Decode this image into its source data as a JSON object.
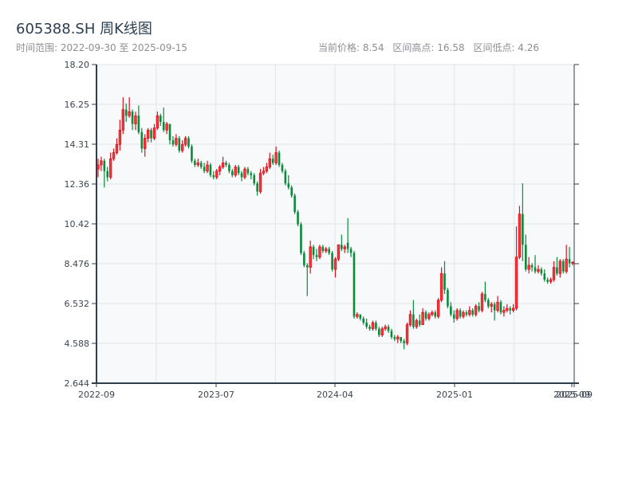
{
  "header": {
    "title": "605388.SH 周K线图",
    "range_label": "时间范围: 2022-09-30 至 2025-09-15",
    "current_price": "当前价格: 8.54",
    "range_high": "区间高点: 16.58",
    "range_low": "区间低点: 4.26"
  },
  "chart_data": {
    "type": "candlestick",
    "title": "605388.SH 周K线图",
    "ylim": [
      2.644,
      18.2
    ],
    "y_ticks": [
      "18.20",
      "16.25",
      "14.31",
      "12.36",
      "10.42",
      "8.476",
      "6.532",
      "4.588",
      "2.644"
    ],
    "x_ticks": [
      "2022-09",
      "2023-07",
      "2024-04",
      "2025-01",
      "2025-09",
      "2025-09"
    ],
    "grid": true,
    "colors": {
      "up": "#e0101e",
      "up_fill": "#f23c3c",
      "down": "#0b8a3a",
      "plot_bg": "#f7f9fb",
      "axis": "#2c3e50",
      "grid": "#e1e5ea"
    },
    "ohlc_fields": [
      "open",
      "high",
      "low",
      "close"
    ],
    "candles": [
      [
        13.1,
        13.6,
        12.7,
        13.3
      ],
      [
        13.3,
        13.7,
        13.0,
        13.5
      ],
      [
        13.5,
        13.6,
        12.2,
        13.0
      ],
      [
        13.0,
        13.2,
        12.5,
        12.7
      ],
      [
        12.7,
        13.9,
        12.6,
        13.6
      ],
      [
        13.6,
        14.1,
        13.5,
        13.9
      ],
      [
        13.9,
        14.6,
        13.8,
        14.3
      ],
      [
        14.3,
        15.5,
        14.0,
        15.0
      ],
      [
        15.0,
        16.6,
        14.8,
        16.0
      ],
      [
        16.0,
        16.3,
        15.4,
        15.7
      ],
      [
        15.7,
        16.6,
        15.6,
        15.9
      ],
      [
        15.9,
        16.0,
        15.0,
        15.3
      ],
      [
        15.3,
        15.9,
        15.0,
        15.7
      ],
      [
        15.7,
        16.2,
        14.8,
        14.9
      ],
      [
        14.9,
        15.1,
        13.9,
        14.1
      ],
      [
        14.1,
        14.8,
        13.7,
        14.6
      ],
      [
        14.6,
        15.1,
        14.4,
        15.0
      ],
      [
        15.0,
        15.1,
        14.4,
        14.6
      ],
      [
        14.6,
        15.3,
        14.5,
        15.1
      ],
      [
        15.1,
        15.9,
        15.0,
        15.7
      ],
      [
        15.7,
        15.8,
        15.2,
        15.4
      ],
      [
        15.4,
        16.1,
        14.9,
        15.0
      ],
      [
        15.0,
        15.4,
        14.8,
        15.3
      ],
      [
        15.3,
        15.3,
        14.3,
        14.5
      ],
      [
        14.5,
        14.7,
        14.2,
        14.3
      ],
      [
        14.3,
        14.8,
        14.2,
        14.6
      ],
      [
        14.6,
        14.7,
        13.9,
        14.0
      ],
      [
        14.0,
        14.5,
        13.9,
        14.3
      ],
      [
        14.3,
        14.7,
        14.2,
        14.6
      ],
      [
        14.6,
        14.7,
        14.1,
        14.2
      ],
      [
        14.2,
        14.3,
        13.4,
        13.5
      ],
      [
        13.5,
        13.6,
        13.2,
        13.3
      ],
      [
        13.3,
        13.6,
        13.2,
        13.4
      ],
      [
        13.4,
        13.5,
        13.1,
        13.2
      ],
      [
        13.2,
        13.4,
        12.9,
        13.0
      ],
      [
        13.0,
        13.5,
        12.9,
        13.3
      ],
      [
        13.3,
        13.4,
        12.7,
        12.8
      ],
      [
        12.8,
        13.0,
        12.6,
        12.7
      ],
      [
        12.7,
        13.1,
        12.6,
        13.0
      ],
      [
        13.0,
        13.3,
        12.8,
        13.2
      ],
      [
        13.2,
        13.7,
        13.1,
        13.4
      ],
      [
        13.4,
        13.5,
        13.2,
        13.3
      ],
      [
        13.3,
        13.4,
        12.9,
        13.0
      ],
      [
        13.0,
        13.1,
        12.7,
        12.8
      ],
      [
        12.8,
        13.3,
        12.7,
        13.2
      ],
      [
        13.2,
        13.3,
        12.8,
        12.9
      ],
      [
        12.9,
        13.0,
        12.5,
        12.7
      ],
      [
        12.7,
        13.2,
        12.6,
        13.1
      ],
      [
        13.1,
        13.2,
        12.8,
        12.9
      ],
      [
        12.9,
        13.0,
        12.6,
        12.8
      ],
      [
        12.8,
        12.9,
        12.3,
        12.4
      ],
      [
        12.4,
        12.5,
        11.8,
        12.0
      ],
      [
        12.0,
        13.1,
        11.9,
        12.9
      ],
      [
        12.9,
        13.2,
        12.8,
        13.0
      ],
      [
        13.0,
        13.4,
        12.9,
        13.2
      ],
      [
        13.2,
        13.9,
        13.1,
        13.6
      ],
      [
        13.6,
        13.8,
        13.3,
        13.4
      ],
      [
        13.4,
        14.2,
        13.3,
        13.9
      ],
      [
        13.9,
        14.0,
        13.2,
        13.3
      ],
      [
        13.3,
        13.4,
        12.9,
        13.0
      ],
      [
        13.0,
        13.1,
        12.3,
        12.4
      ],
      [
        12.4,
        12.8,
        12.1,
        12.2
      ],
      [
        12.2,
        12.3,
        11.7,
        11.8
      ],
      [
        11.8,
        11.9,
        10.9,
        11.0
      ],
      [
        11.0,
        11.1,
        10.3,
        10.4
      ],
      [
        10.4,
        10.5,
        8.9,
        9.0
      ],
      [
        9.0,
        9.1,
        8.3,
        8.4
      ],
      [
        8.4,
        8.5,
        6.9,
        8.3
      ],
      [
        8.3,
        9.6,
        8.0,
        9.3
      ],
      [
        9.3,
        9.4,
        8.7,
        8.9
      ],
      [
        8.9,
        9.2,
        8.6,
        8.8
      ],
      [
        8.8,
        9.4,
        8.7,
        9.3
      ],
      [
        9.3,
        9.4,
        9.0,
        9.1
      ],
      [
        9.1,
        9.3,
        9.0,
        9.2
      ],
      [
        9.2,
        9.3,
        8.9,
        9.0
      ],
      [
        9.0,
        9.1,
        8.1,
        8.2
      ],
      [
        8.2,
        8.8,
        7.8,
        8.7
      ],
      [
        8.7,
        9.4,
        8.6,
        9.4
      ],
      [
        9.4,
        9.9,
        9.1,
        9.2
      ],
      [
        9.2,
        9.4,
        9.0,
        9.3
      ],
      [
        9.5,
        10.7,
        9.0,
        9.2
      ],
      [
        9.2,
        9.3,
        8.8,
        9.0
      ],
      [
        9.0,
        9.1,
        5.8,
        5.9
      ],
      [
        5.9,
        6.1,
        5.8,
        6.0
      ],
      [
        6.0,
        6.0,
        5.7,
        5.8
      ],
      [
        5.8,
        5.9,
        5.5,
        5.6
      ],
      [
        5.6,
        5.8,
        5.3,
        5.4
      ],
      [
        5.4,
        5.5,
        5.2,
        5.3
      ],
      [
        5.3,
        5.7,
        5.2,
        5.6
      ],
      [
        5.6,
        5.7,
        5.2,
        5.3
      ],
      [
        5.3,
        5.4,
        4.9,
        5.0
      ],
      [
        5.0,
        5.4,
        4.9,
        5.3
      ],
      [
        5.3,
        5.5,
        5.2,
        5.4
      ],
      [
        5.4,
        5.5,
        5.1,
        5.2
      ],
      [
        5.2,
        5.3,
        4.8,
        4.9
      ],
      [
        4.9,
        5.0,
        4.7,
        4.8
      ],
      [
        4.8,
        5.0,
        4.6,
        4.9
      ],
      [
        4.9,
        4.9,
        4.6,
        4.7
      ],
      [
        4.7,
        4.8,
        4.3,
        4.6
      ],
      [
        4.6,
        5.6,
        4.5,
        5.5
      ],
      [
        5.5,
        6.2,
        5.4,
        6.0
      ],
      [
        6.0,
        6.7,
        5.3,
        5.4
      ],
      [
        5.4,
        5.8,
        5.3,
        5.7
      ],
      [
        5.7,
        6.0,
        5.4,
        5.5
      ],
      [
        5.5,
        6.3,
        5.5,
        6.1
      ],
      [
        6.1,
        6.2,
        5.7,
        5.8
      ],
      [
        5.8,
        6.1,
        5.7,
        6.0
      ],
      [
        6.0,
        6.2,
        5.9,
        6.1
      ],
      [
        6.1,
        6.2,
        5.8,
        5.9
      ],
      [
        5.9,
        6.8,
        5.8,
        6.7
      ],
      [
        6.7,
        8.3,
        6.6,
        8.0
      ],
      [
        8.0,
        8.6,
        7.0,
        7.2
      ],
      [
        7.2,
        7.3,
        6.3,
        6.4
      ],
      [
        6.4,
        6.6,
        5.9,
        6.0
      ],
      [
        6.0,
        6.2,
        5.6,
        5.8
      ],
      [
        5.8,
        6.3,
        5.7,
        6.2
      ],
      [
        6.2,
        6.3,
        5.8,
        5.9
      ],
      [
        5.9,
        6.2,
        5.8,
        6.1
      ],
      [
        6.1,
        6.2,
        5.9,
        6.0
      ],
      [
        6.0,
        6.4,
        5.9,
        6.2
      ],
      [
        6.2,
        6.3,
        5.9,
        6.0
      ],
      [
        6.0,
        6.5,
        5.9,
        6.4
      ],
      [
        6.4,
        6.6,
        6.1,
        6.2
      ],
      [
        6.2,
        7.1,
        6.1,
        7.0
      ],
      [
        7.0,
        7.6,
        6.6,
        6.7
      ],
      [
        6.7,
        6.8,
        6.3,
        6.4
      ],
      [
        6.4,
        6.6,
        6.1,
        6.5
      ],
      [
        6.5,
        6.6,
        5.7,
        6.2
      ],
      [
        6.2,
        6.9,
        6.1,
        6.6
      ],
      [
        6.6,
        6.7,
        6.0,
        6.1
      ],
      [
        6.1,
        6.4,
        5.9,
        6.2
      ],
      [
        6.2,
        6.5,
        6.1,
        6.3
      ],
      [
        6.3,
        6.4,
        6.0,
        6.2
      ],
      [
        6.2,
        6.5,
        6.1,
        6.3
      ],
      [
        6.3,
        10.3,
        6.2,
        8.8
      ],
      [
        8.8,
        11.3,
        8.7,
        10.9
      ],
      [
        10.9,
        12.4,
        8.6,
        9.4
      ],
      [
        9.4,
        9.9,
        8.1,
        8.2
      ],
      [
        8.2,
        8.8,
        8.0,
        8.4
      ],
      [
        8.4,
        8.5,
        8.1,
        8.3
      ],
      [
        8.3,
        8.9,
        8.0,
        8.1
      ],
      [
        8.1,
        8.4,
        8.0,
        8.2
      ],
      [
        8.2,
        8.3,
        7.9,
        8.0
      ],
      [
        8.0,
        8.2,
        7.6,
        7.7
      ],
      [
        7.7,
        7.8,
        7.5,
        7.6
      ],
      [
        7.6,
        7.8,
        7.5,
        7.7
      ],
      [
        7.7,
        8.6,
        7.6,
        8.3
      ],
      [
        8.3,
        8.8,
        7.9,
        8.0
      ],
      [
        8.0,
        8.7,
        7.8,
        8.6
      ],
      [
        8.6,
        8.7,
        8.0,
        8.1
      ],
      [
        8.1,
        9.4,
        8.0,
        8.7
      ],
      [
        8.7,
        9.3,
        8.3,
        8.5
      ],
      [
        8.5,
        8.6,
        8.4,
        8.54
      ]
    ]
  }
}
